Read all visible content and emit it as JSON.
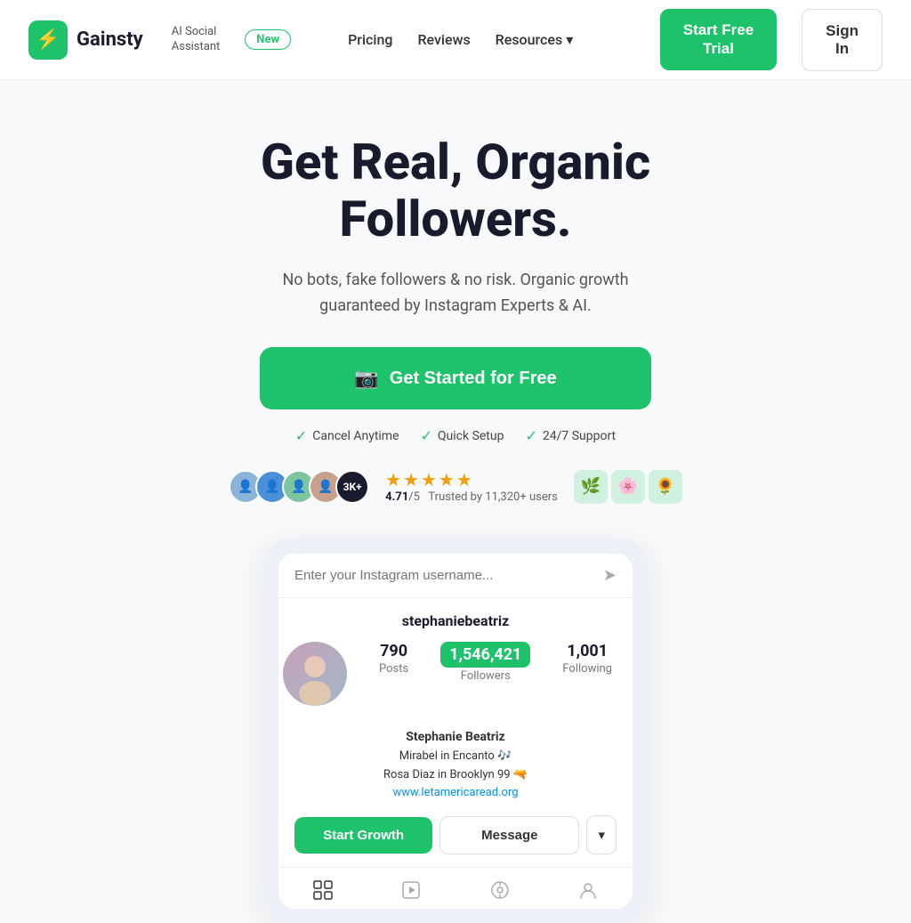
{
  "brand": {
    "icon": "⚡",
    "name": "Gainsty",
    "tagline": "AI Social\nAssistant"
  },
  "nav": {
    "new_badge": "New",
    "links": [
      {
        "label": "Pricing",
        "dropdown": false
      },
      {
        "label": "Reviews",
        "dropdown": false
      },
      {
        "label": "Resources",
        "dropdown": true
      }
    ],
    "cta_primary": "Start Free\nTrial",
    "cta_secondary": "Sign\nIn"
  },
  "hero": {
    "title": "Get Real, Organic Followers.",
    "subtitle": "No bots, fake followers & no risk. Organic growth guaranteed by Instagram Experts & AI.",
    "cta_label": "Get Started for Free",
    "checks": [
      {
        "label": "Cancel Anytime"
      },
      {
        "label": "Quick Setup"
      },
      {
        "label": "24/7 Support"
      }
    ]
  },
  "social_proof": {
    "rating": "4.71",
    "rating_denom": "/5",
    "trusted_text": "Trusted by 11,320+ users",
    "avatar_count": "3K+",
    "stars": "★★★★★"
  },
  "profile": {
    "search_placeholder": "Enter your Instagram username...",
    "username": "stephaniebeatriz",
    "posts": "790",
    "posts_label": "Posts",
    "followers": "1,546,421",
    "followers_label": "Followers",
    "following": "1,001",
    "following_label": "Following",
    "name": "Stephanie Beatriz",
    "bio_line1": "Mirabel in Encanto 🎶",
    "bio_line2": "Rosa Diaz in Brooklyn 99 🔫",
    "bio_link": "www.letamericaread.org",
    "btn_growth": "Start Growth",
    "btn_message": "Message",
    "btn_dropdown": "▾"
  },
  "colors": {
    "green": "#1ec26b",
    "dark": "#1a1a2e",
    "light_bg": "#f8f9fb"
  }
}
